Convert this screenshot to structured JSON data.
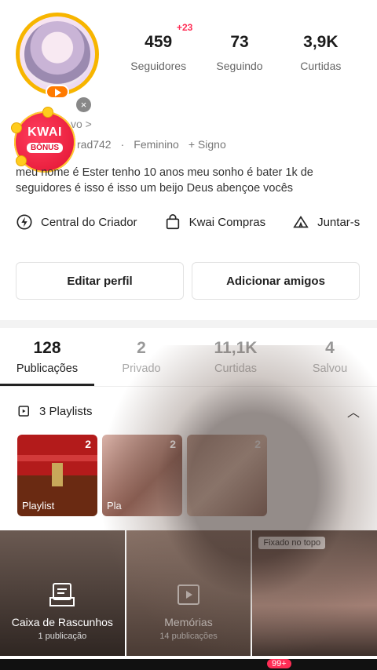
{
  "profile": {
    "stats": [
      {
        "value": "459",
        "label": "Seguidores"
      },
      {
        "value": "73",
        "label": "Seguindo"
      },
      {
        "value": "3,9K",
        "label": "Curtidas"
      }
    ],
    "followers_delta": "+23",
    "meta_partial": "vo >",
    "username_partial": "rad742",
    "gender": "Feminino",
    "sign": "+ Signo",
    "bio": "meu nome é Ester tenho 10 anos meu sonho é bater 1k de seguidores é isso é isso um beijo Deus abençoe vocês"
  },
  "bonus": {
    "line1": "KWAI",
    "line2": "BÔNUS"
  },
  "links": [
    {
      "label": "Central do Criador",
      "icon": "lightning-circle-icon"
    },
    {
      "label": "Kwai Compras",
      "icon": "shopping-bag-icon"
    },
    {
      "label": "Juntar-s",
      "icon": "tent-icon"
    }
  ],
  "buttons": {
    "edit": "Editar perfil",
    "add": "Adicionar amigos"
  },
  "tabs": [
    {
      "value": "128",
      "label": "Publicações",
      "active": true
    },
    {
      "value": "2",
      "label": "Privado"
    },
    {
      "value": "11,1K",
      "label": "Curtidas"
    },
    {
      "value": "4",
      "label": "Salvou"
    }
  ],
  "playlists": {
    "header": "3 Playlists",
    "items": [
      {
        "caption": "Playlist",
        "count": "2"
      },
      {
        "caption": "Pla",
        "count": "2"
      },
      {
        "caption": "",
        "count": "2"
      }
    ]
  },
  "grid": {
    "drafts_title": "Caixa de Rascunhos",
    "drafts_sub": "1 publicação",
    "memories_title": "Memórias",
    "memories_sub": "14 publicações",
    "pinned": "Fixado no topo"
  },
  "bottom": {
    "badge": "99+"
  },
  "colors": {
    "accent": "#ff2d55",
    "ring": "#f7b500",
    "bonus": "#e0102f"
  }
}
